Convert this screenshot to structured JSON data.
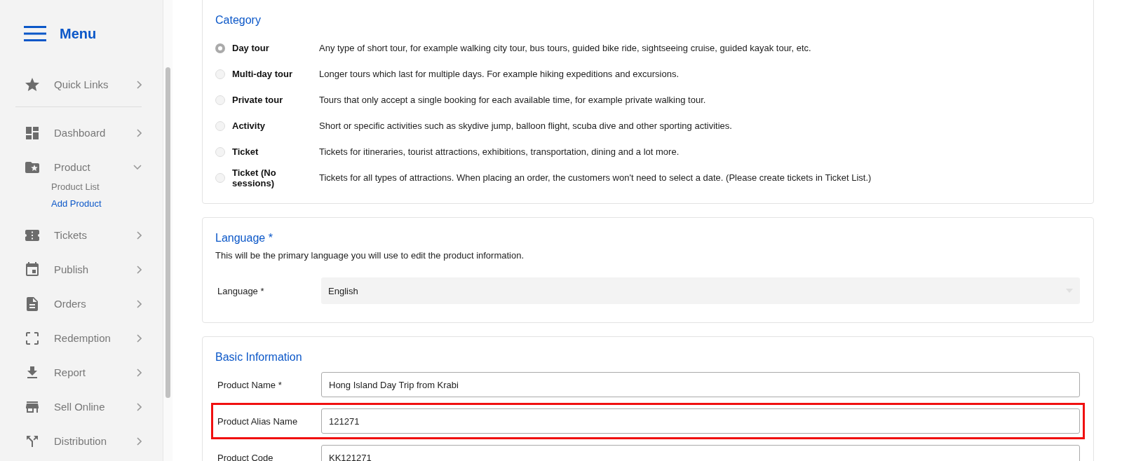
{
  "sidebar": {
    "title": "Menu",
    "quick_links": {
      "label": "Quick Links"
    },
    "items": [
      {
        "label": "Dashboard",
        "expanded": false
      },
      {
        "label": "Product",
        "expanded": true,
        "children": [
          {
            "label": "Product List",
            "selected": false
          },
          {
            "label": "Add Product",
            "selected": true
          }
        ]
      },
      {
        "label": "Tickets",
        "expanded": false
      },
      {
        "label": "Publish",
        "expanded": false
      },
      {
        "label": "Orders",
        "expanded": false
      },
      {
        "label": "Redemption",
        "expanded": false
      },
      {
        "label": "Report",
        "expanded": false
      },
      {
        "label": "Sell Online",
        "expanded": false
      },
      {
        "label": "Distribution",
        "expanded": false
      }
    ]
  },
  "category": {
    "title": "Category",
    "options": [
      {
        "label": "Day tour",
        "selected": true,
        "description": "Any type of short tour, for example walking city tour, bus tours, guided bike ride, sightseeing cruise, guided kayak tour, etc."
      },
      {
        "label": "Multi-day tour",
        "selected": false,
        "description": "Longer tours which last for multiple days. For example hiking expeditions and excursions."
      },
      {
        "label": "Private tour",
        "selected": false,
        "description": "Tours that only accept a single booking for each available time, for example private walking tour."
      },
      {
        "label": "Activity",
        "selected": false,
        "description": "Short or specific activities such as skydive jump, balloon flight, scuba dive and other sporting activities."
      },
      {
        "label": "Ticket",
        "selected": false,
        "description": "Tickets for itineraries, tourist attractions, exhibitions, transportation, dining and a lot more."
      },
      {
        "label": "Ticket (No sessions)",
        "selected": false,
        "description": "Tickets for all types of attractions. When placing an order, the customers won't need to select a date. (Please create tickets in Ticket List.)"
      }
    ]
  },
  "language": {
    "title": "Language *",
    "description": "This will be the primary language you will use to edit the product information.",
    "field": {
      "label": "Language *",
      "value": "English"
    }
  },
  "basic_information": {
    "title": "Basic Information",
    "fields": [
      {
        "label": "Product Name *",
        "value": "Hong Island Day Trip from Krabi",
        "highlighted": false
      },
      {
        "label": "Product Alias Name",
        "value": "121271",
        "highlighted": true
      },
      {
        "label": "Product Code",
        "value": "KK121271",
        "highlighted": false
      }
    ]
  }
}
